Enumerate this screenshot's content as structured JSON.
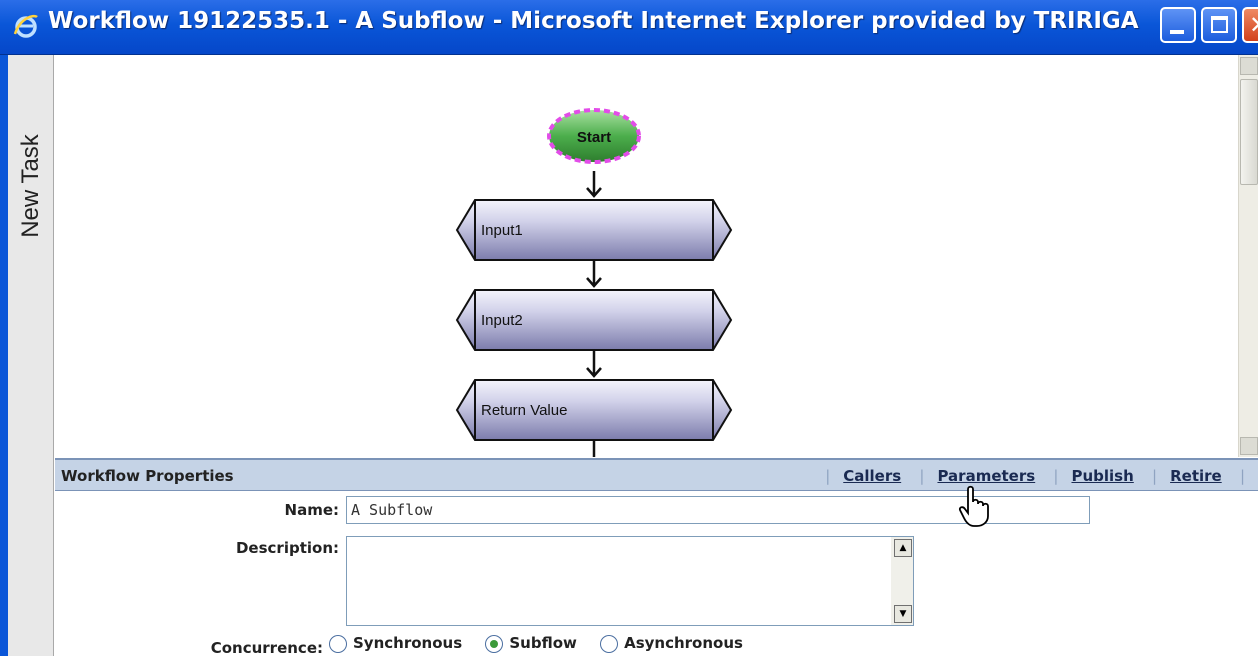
{
  "window": {
    "title": "Workflow 19122535.1 - A Subflow - Microsoft Internet Explorer provided by TRIRIGA",
    "icon": "internet-explorer-icon"
  },
  "side_tab": {
    "label": "New Task"
  },
  "diagram": {
    "start_label": "Start",
    "tasks": [
      "Input1",
      "Input2",
      "Return Value"
    ],
    "colors": {
      "start_fill": "#4cae4c",
      "start_border": "#e24ce8",
      "task_fill_top": "#e4e4f3",
      "task_fill_bottom": "#8a8ab8"
    }
  },
  "properties": {
    "header_title": "Workflow Properties",
    "links": [
      "Callers",
      "Parameters",
      "Publish",
      "Retire"
    ],
    "name_label": "Name:",
    "name_value": "A Subflow",
    "description_label": "Description:",
    "description_value": "",
    "concurrence_label": "Concurrence:",
    "concurrence_options": [
      "Synchronous",
      "Subflow",
      "Asynchronous"
    ],
    "concurrence_selected": "Subflow"
  }
}
